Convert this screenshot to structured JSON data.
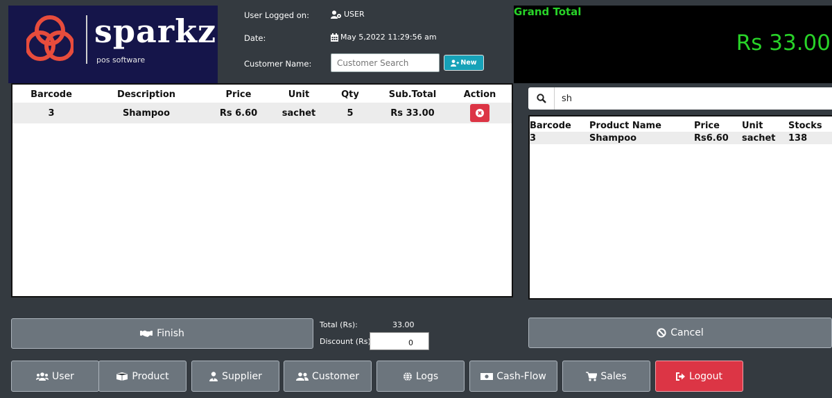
{
  "logo": {
    "word": "sparkz",
    "tagline": "pos software"
  },
  "header": {
    "user_label": "User Logged on:",
    "user_value": "USER",
    "date_label": "Date:",
    "date_value": "May 5,2022 11:29:56 am",
    "customer_label": "Customer Name:",
    "customer_placeholder": "Customer Search",
    "new_button": "New"
  },
  "grand_total": {
    "label": "Grand Total",
    "value": "Rs 33.00"
  },
  "cart": {
    "columns": [
      "Barcode",
      "Description",
      "Price",
      "Unit",
      "Qty",
      "Sub.Total",
      "Action"
    ],
    "rows": [
      {
        "barcode": "3",
        "description": "Shampoo",
        "price": "Rs 6.60",
        "unit": "sachet",
        "qty": "5",
        "subtotal": "Rs 33.00"
      }
    ]
  },
  "search": {
    "value": "sh"
  },
  "products": {
    "columns": [
      "Barcode",
      "Product Name",
      "Price",
      "Unit",
      "Stocks"
    ],
    "rows": [
      {
        "barcode": "3",
        "name": "Shampoo",
        "price": "Rs6.60",
        "unit": "sachet",
        "stocks": "138"
      }
    ]
  },
  "summary": {
    "finish_label": "Finish",
    "total_label": "Total (Rs):",
    "total_value": "33.00",
    "discount_label": "Discount (Rs):",
    "discount_value": "0",
    "cancel_label": "Cancel"
  },
  "nav": {
    "user": "User",
    "product": "Product",
    "supplier": "Supplier",
    "customer": "Customer",
    "logs": "Logs",
    "cashflow": "Cash-Flow",
    "sales": "Sales",
    "logout": "Logout"
  },
  "colors": {
    "brand_red": "#e74c3c",
    "logo_bg": "#15154a",
    "grand_total_green": "#28d228",
    "danger": "#dc3545",
    "info": "#17a2b8",
    "button_gray": "#6c757d",
    "background": "#343a40"
  }
}
